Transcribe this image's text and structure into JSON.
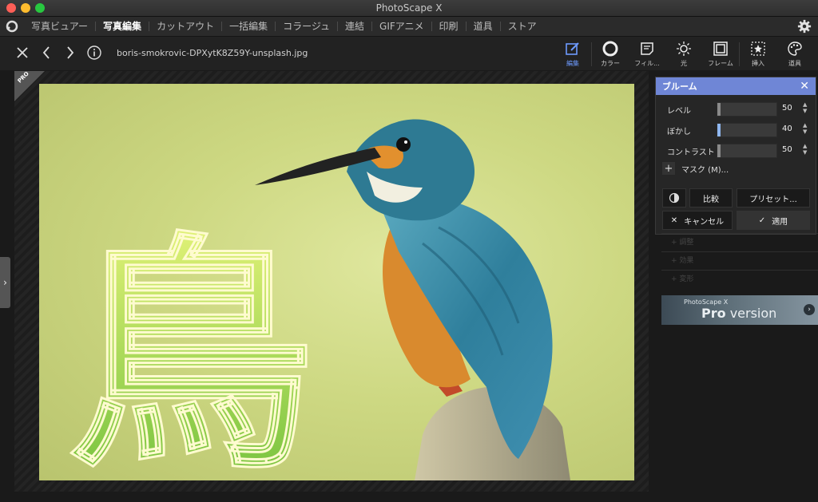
{
  "window": {
    "title": "PhotoScape X"
  },
  "menu": {
    "items": [
      {
        "label": "写真ビュアー",
        "active": false
      },
      {
        "label": "写真編集",
        "active": true
      },
      {
        "label": "カットアウト",
        "active": false
      },
      {
        "label": "一括編集",
        "active": false
      },
      {
        "label": "コラージュ",
        "active": false
      },
      {
        "label": "連結",
        "active": false
      },
      {
        "label": "GIFアニメ",
        "active": false
      },
      {
        "label": "印刷",
        "active": false
      },
      {
        "label": "道具",
        "active": false
      },
      {
        "label": "ストア",
        "active": false
      }
    ]
  },
  "toolbar": {
    "filename": "boris-smokrovic-DPXytK8Z59Y-unsplash.jpg",
    "tools": [
      {
        "label": "編集",
        "icon": "edit-icon",
        "active": true
      },
      {
        "label": "カラー",
        "icon": "color-icon",
        "active": false
      },
      {
        "label": "フィル...",
        "icon": "film-icon",
        "active": false
      },
      {
        "label": "光",
        "icon": "light-icon",
        "active": false
      },
      {
        "label": "フレーム",
        "icon": "frame-icon",
        "active": false
      },
      {
        "label": "挿入",
        "icon": "insert-icon",
        "active": false
      },
      {
        "label": "道具",
        "icon": "palette-icon",
        "active": false
      }
    ]
  },
  "canvas": {
    "pro_badge": "PRO",
    "overlay_text": "鳥"
  },
  "bloom_panel": {
    "title": "ブルーム",
    "sliders": [
      {
        "label": "レベル",
        "value": 50,
        "max": 100
      },
      {
        "label": "ぼかし",
        "value": 40,
        "max": 100
      },
      {
        "label": "コントラスト",
        "value": 50,
        "max": 100
      }
    ],
    "mask_label": "マスク (M)...",
    "compare_label": "比較",
    "preset_label": "プリセット...",
    "cancel_label": "キャンセル",
    "apply_label": "適用"
  },
  "collapsed_sections": [
    "調整",
    "効果",
    "変形"
  ],
  "pro_banner": {
    "small": "PhotoScape X",
    "big_bold": "Pro",
    "big_rest": " version"
  },
  "colors": {
    "accent": "#6f86d6",
    "active_tool": "#6e9bff"
  }
}
